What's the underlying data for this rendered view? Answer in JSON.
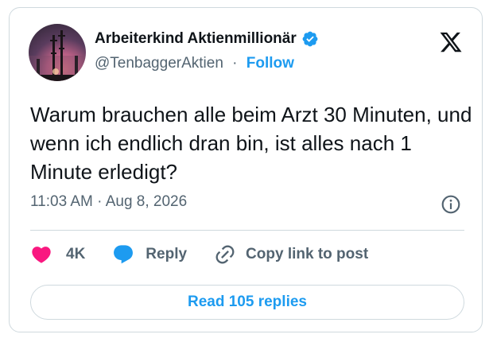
{
  "author": {
    "display_name": "Arbeiterkind Aktienmillionär",
    "handle": "@TenbaggerAktien",
    "separator": "·",
    "follow_label": "Follow",
    "verified": true
  },
  "tweet": {
    "text": "Warum brauchen alle beim Arzt 30 Minuten, und wenn ich endlich dran bin, ist alles nach 1 Minute erledigt?",
    "timestamp": "11:03 AM · Aug 8, 2026"
  },
  "actions": {
    "like_count": "4K",
    "reply_label": "Reply",
    "copy_link_label": "Copy link to post"
  },
  "read_replies_label": "Read 105 replies",
  "colors": {
    "accent": "#1d9bf0",
    "like": "#f91880",
    "text_primary": "#0f1419",
    "text_secondary": "#536471",
    "border": "#cfd9de"
  },
  "icons": {
    "logo": "x-logo-icon",
    "verified": "verified-badge-icon",
    "info": "info-icon",
    "like": "heart-icon",
    "reply": "speech-bubble-icon",
    "copy_link": "link-icon"
  }
}
